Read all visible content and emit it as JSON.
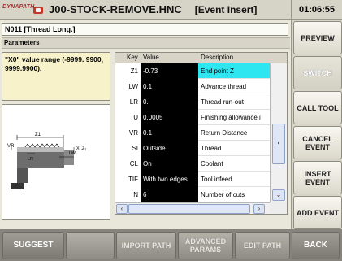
{
  "header": {
    "logo_text": "DYNAPATH",
    "file_name": "J00-STOCK-REMOVE.HNC",
    "mode": "[Event Insert]",
    "time": "01:06:55"
  },
  "event": {
    "name": "N011 [Thread Long.]",
    "section": "Parameters",
    "range_note": "\"X0\" value range (-9999. 9900, 9999.9900)."
  },
  "table": {
    "columns": {
      "key": "Key",
      "value": "Value",
      "description": "Description"
    },
    "rows": [
      {
        "key": "Z1",
        "value": "-0.73",
        "description": "End point Z",
        "active": true
      },
      {
        "key": "LW",
        "value": "0.1",
        "description": "Advance thread"
      },
      {
        "key": "LR",
        "value": "0.",
        "description": "Thread run-out"
      },
      {
        "key": "U",
        "value": "0.0005",
        "description": "Finishing allowance i"
      },
      {
        "key": "VR",
        "value": "0.1",
        "description": "Return Distance"
      },
      {
        "key": "SI",
        "value": "Outside",
        "description": "Thread"
      },
      {
        "key": "CL",
        "value": "On",
        "description": "Coolant"
      },
      {
        "key": "TIF",
        "value": "With two edges",
        "description": "Tool infeed"
      },
      {
        "key": "N",
        "value": "6",
        "description": "Number of cuts"
      }
    ]
  },
  "diagram": {
    "labels": {
      "z1": "Z1",
      "vr": "VR",
      "lr": "LR",
      "lw": "LW",
      "xz": "X₁,Z₁"
    }
  },
  "right_buttons": [
    {
      "label": "PREVIEW",
      "enabled": true
    },
    {
      "label": "SWITCH",
      "enabled": false
    },
    {
      "label": "CALL TOOL",
      "enabled": true
    },
    {
      "label": "CANCEL EVENT",
      "enabled": true
    },
    {
      "label": "INSERT EVENT",
      "enabled": true
    },
    {
      "label": "ADD EVENT",
      "enabled": true
    }
  ],
  "bottom_buttons": [
    {
      "label": "SUGGEST",
      "enabled": true
    },
    {
      "label": "",
      "enabled": true
    },
    {
      "label": "IMPORT PATH",
      "enabled": false
    },
    {
      "label": "ADVANCED PARAMS",
      "enabled": false
    },
    {
      "label": "EDIT PATH",
      "enabled": false
    },
    {
      "label": "BACK",
      "enabled": true
    }
  ],
  "colors": {
    "active_row": "#2ee6f0",
    "range_box": "#f7f2c9",
    "value_cell": "#000000"
  }
}
